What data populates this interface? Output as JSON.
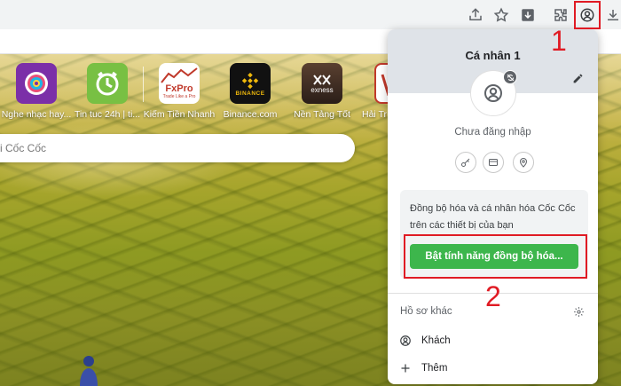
{
  "toolbar": {
    "icons": [
      "share-icon",
      "star-icon",
      "download-box-icon",
      "extensions-icon",
      "profile-icon",
      "download-icon"
    ]
  },
  "ntp": {
    "shortcuts": [
      {
        "label": "Nghe nhạc hay...",
        "icon": "music-disc-icon",
        "color": "#7b2fa8"
      },
      {
        "label": "Tin tuc 24h | ti...",
        "icon": "clock-icon",
        "color": "#78c043"
      },
      {
        "label": "Kiếm Tiền Nhanh",
        "icon": "fxpro-logo",
        "color": "#ffffff",
        "logo_text": "FxPro",
        "logo_sub": "Trade Like a Pro"
      },
      {
        "label": "Binance.com",
        "icon": "binance-logo",
        "color": "#111111",
        "logo_text": "BINANCE"
      },
      {
        "label": "Nền Tảng Tốt",
        "icon": "exness-logo",
        "color": "#3a2a20",
        "logo_text": "exness"
      },
      {
        "label": "Hải Tri",
        "icon": "partial-logo",
        "color": "#ffffff"
      }
    ],
    "search_placeholder": "i Cốc Cốc"
  },
  "popup": {
    "title": "Cá nhân 1",
    "status": "Chưa đăng nhập",
    "sync_text": "Đồng bộ hóa và cá nhân hóa Cốc Cốc trên các thiết bị của bạn",
    "sync_button": "Bật tính năng đồng bộ hóa...",
    "other_profiles": "Hồ sơ khác",
    "guest": "Khách",
    "add": "Thêm"
  },
  "annotations": {
    "one": "1",
    "two": "2"
  },
  "colors": {
    "sync_green": "#3db64c",
    "annotation_red": "#e01b24",
    "header_gray": "#dfe3e8"
  }
}
